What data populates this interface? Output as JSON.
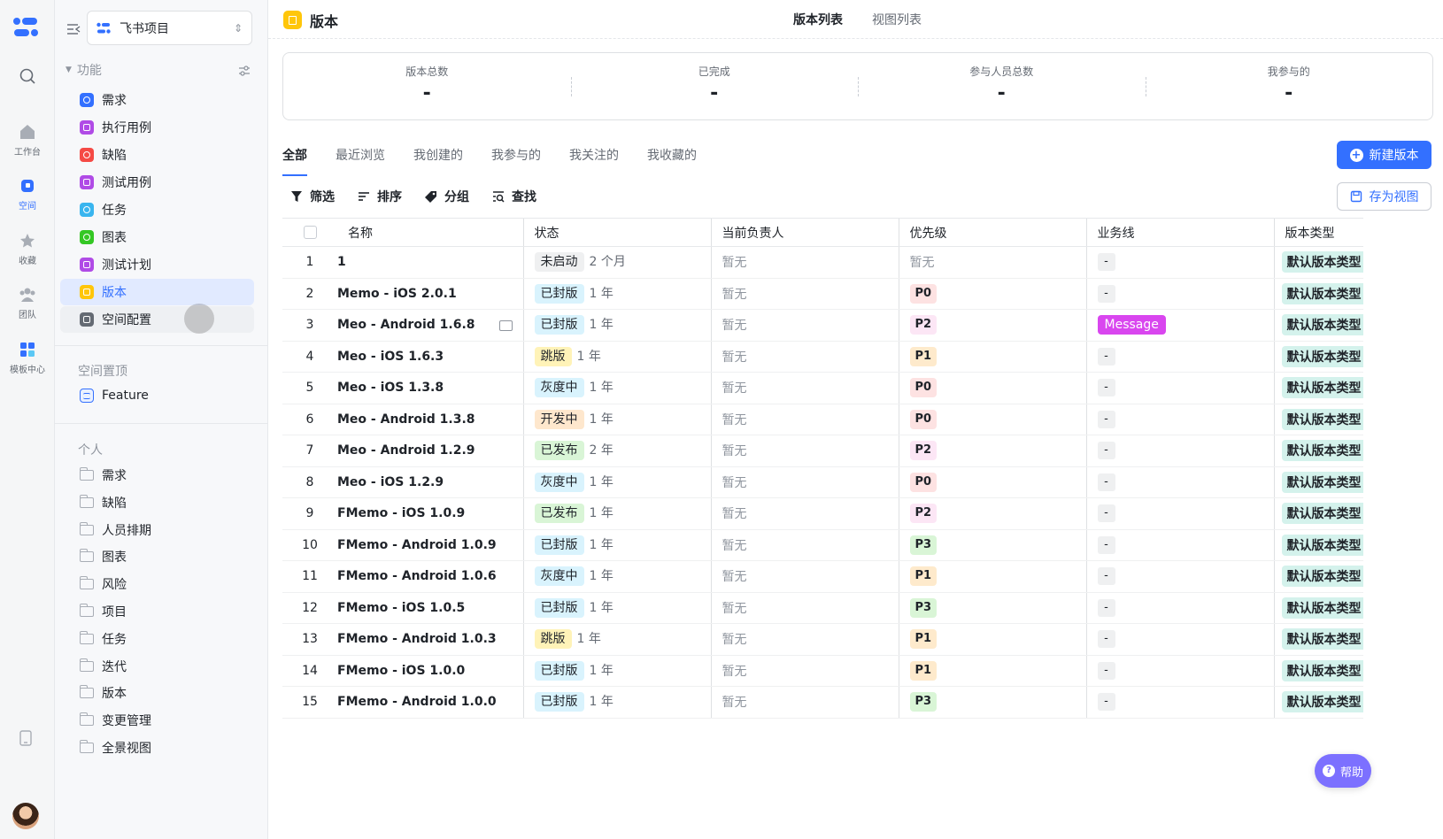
{
  "rail": {
    "items": [
      {
        "label": "",
        "icon": "search-icon"
      },
      {
        "label": "工作台",
        "icon": "home-icon"
      },
      {
        "label": "空间",
        "icon": "space-icon",
        "active": true
      },
      {
        "label": "收藏",
        "icon": "star-icon"
      },
      {
        "label": "团队",
        "icon": "team-icon"
      },
      {
        "label": "模板中心",
        "icon": "template-icon"
      }
    ]
  },
  "sidebar": {
    "project_name": "飞书项目",
    "features_title": "功能",
    "features": [
      {
        "label": "需求",
        "color": "#3370ff",
        "icon": "requirement-icon"
      },
      {
        "label": "执行用例",
        "color": "#b04be6",
        "icon": "test-case-icon"
      },
      {
        "label": "缺陷",
        "color": "#f54a45",
        "icon": "bug-icon"
      },
      {
        "label": "测试用例",
        "color": "#b04be6",
        "icon": "test-case-icon"
      },
      {
        "label": "任务",
        "color": "#39b5ef",
        "icon": "task-icon"
      },
      {
        "label": "图表",
        "color": "#34c724",
        "icon": "chart-icon"
      },
      {
        "label": "测试计划",
        "color": "#b04be6",
        "icon": "test-plan-icon"
      },
      {
        "label": "版本",
        "color": "#ffc60a",
        "icon": "version-icon"
      },
      {
        "label": "空间配置",
        "color": "#646a73",
        "icon": "settings-icon"
      }
    ],
    "pinned_title": "空间置顶",
    "pinned": [
      {
        "label": "Feature"
      }
    ],
    "personal_title": "个人",
    "personal": [
      "需求",
      "缺陷",
      "人员排期",
      "图表",
      "风险",
      "项目",
      "任务",
      "迭代",
      "版本",
      "变更管理",
      "全景视图"
    ]
  },
  "header": {
    "title": "版本",
    "view_tabs": [
      "版本列表",
      "视图列表"
    ]
  },
  "stats": [
    {
      "label": "版本总数",
      "value": "-"
    },
    {
      "label": "已完成",
      "value": "-"
    },
    {
      "label": "参与人员总数",
      "value": "-"
    },
    {
      "label": "我参与的",
      "value": "-"
    }
  ],
  "filter_tabs": [
    "全部",
    "最近浏览",
    "我创建的",
    "我参与的",
    "我关注的",
    "我收藏的"
  ],
  "actions": {
    "new_version": "新建版本",
    "save_view": "存为视图",
    "filter": "筛选",
    "sort": "排序",
    "group": "分组",
    "find": "查找"
  },
  "table": {
    "columns": [
      "名称",
      "状态",
      "当前负责人",
      "优先级",
      "业务线",
      "版本类型"
    ],
    "rows": [
      {
        "n": "1",
        "name": "1",
        "status": "未启动",
        "age": "2 个月",
        "owner": "暂无",
        "priority": "暂无",
        "line": "-",
        "type": "默认版本类型"
      },
      {
        "n": "2",
        "name": "Memo - iOS 2.0.1",
        "status": "已封版",
        "age": "1 年",
        "owner": "暂无",
        "priority": "P0",
        "line": "-",
        "type": "默认版本类型"
      },
      {
        "n": "3",
        "name": "Meo - Android 1.6.8",
        "status": "已封版",
        "age": "1 年",
        "owner": "暂无",
        "priority": "P2",
        "line": "Message",
        "type": "默认版本类型",
        "comment": true
      },
      {
        "n": "4",
        "name": "Meo - iOS 1.6.3",
        "status": "跳版",
        "age": "1 年",
        "owner": "暂无",
        "priority": "P1",
        "line": "-",
        "type": "默认版本类型"
      },
      {
        "n": "5",
        "name": "Meo - iOS 1.3.8",
        "status": "灰度中",
        "age": "1 年",
        "owner": "暂无",
        "priority": "P0",
        "line": "-",
        "type": "默认版本类型"
      },
      {
        "n": "6",
        "name": "Meo - Android 1.3.8",
        "status": "开发中",
        "age": "1 年",
        "owner": "暂无",
        "priority": "P0",
        "line": "-",
        "type": "默认版本类型"
      },
      {
        "n": "7",
        "name": "Meo - Android 1.2.9",
        "status": "已发布",
        "age": "2 年",
        "owner": "暂无",
        "priority": "P2",
        "line": "-",
        "type": "默认版本类型"
      },
      {
        "n": "8",
        "name": "Meo - iOS 1.2.9",
        "status": "灰度中",
        "age": "1 年",
        "owner": "暂无",
        "priority": "P0",
        "line": "-",
        "type": "默认版本类型"
      },
      {
        "n": "9",
        "name": "FMemo - iOS 1.0.9",
        "status": "已发布",
        "age": "1 年",
        "owner": "暂无",
        "priority": "P2",
        "line": "-",
        "type": "默认版本类型"
      },
      {
        "n": "10",
        "name": "FMemo - Android 1.0.9",
        "status": "已封版",
        "age": "1 年",
        "owner": "暂无",
        "priority": "P3",
        "line": "-",
        "type": "默认版本类型"
      },
      {
        "n": "11",
        "name": "FMemo - Android 1.0.6",
        "status": "灰度中",
        "age": "1 年",
        "owner": "暂无",
        "priority": "P1",
        "line": "-",
        "type": "默认版本类型"
      },
      {
        "n": "12",
        "name": "FMemo - iOS 1.0.5",
        "status": "已封版",
        "age": "1 年",
        "owner": "暂无",
        "priority": "P3",
        "line": "-",
        "type": "默认版本类型"
      },
      {
        "n": "13",
        "name": "FMemo - Android 1.0.3",
        "status": "跳版",
        "age": "1 年",
        "owner": "暂无",
        "priority": "P1",
        "line": "-",
        "type": "默认版本类型"
      },
      {
        "n": "14",
        "name": "FMemo - iOS 1.0.0",
        "status": "已封版",
        "age": "1 年",
        "owner": "暂无",
        "priority": "P1",
        "line": "-",
        "type": "默认版本类型"
      },
      {
        "n": "15",
        "name": "FMemo - Android 1.0.0",
        "status": "已封版",
        "age": "1 年",
        "owner": "暂无",
        "priority": "P3",
        "line": "-",
        "type": "默认版本类型"
      }
    ]
  },
  "colors": {
    "status": {
      "未启动": "#eff0f1",
      "已封版": "#d9f3fd",
      "跳版": "#fff3b8",
      "灰度中": "#d9f3fd",
      "开发中": "#fee7cd",
      "已发布": "#d9f5d6"
    },
    "priority": {
      "P0": "#fde2e2",
      "P1": "#feeacc",
      "P2": "#fce6f5",
      "P3": "#d9f5d6"
    }
  },
  "help_label": "帮助"
}
